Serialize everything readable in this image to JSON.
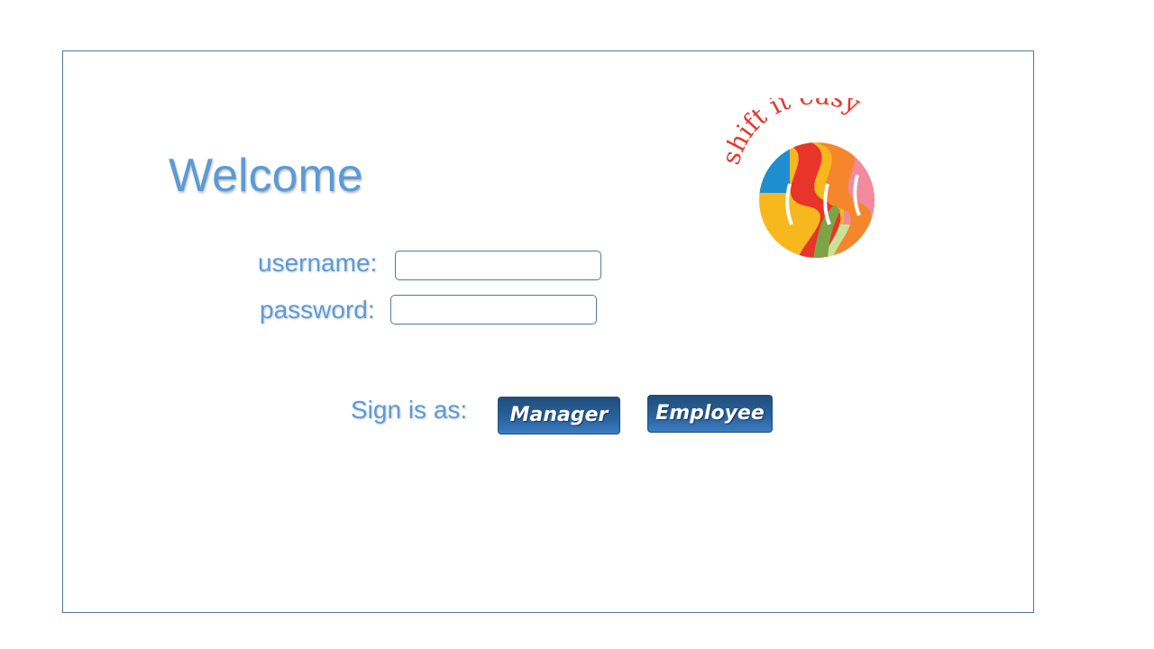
{
  "login": {
    "welcome": "Welcome",
    "username_label": "username:",
    "password_label": "password:",
    "username_value": "",
    "password_value": "",
    "signin_label": "Sign is as:",
    "manager_button": "Manager",
    "employee_button": "Employee"
  },
  "logo": {
    "wordmark": "shift it easy",
    "icon": "shift-it-easy-logo"
  },
  "colors": {
    "accent_text": "#5b9bd5",
    "button_dark": "#1f4e79",
    "frame_border": "#4f79a0",
    "logo_red": "#e8342a",
    "logo_orange": "#f5862b",
    "logo_blue": "#1d8fd1",
    "logo_yellow": "#f7b81e",
    "logo_pink": "#f08a9c",
    "logo_green": "#7ea344"
  }
}
